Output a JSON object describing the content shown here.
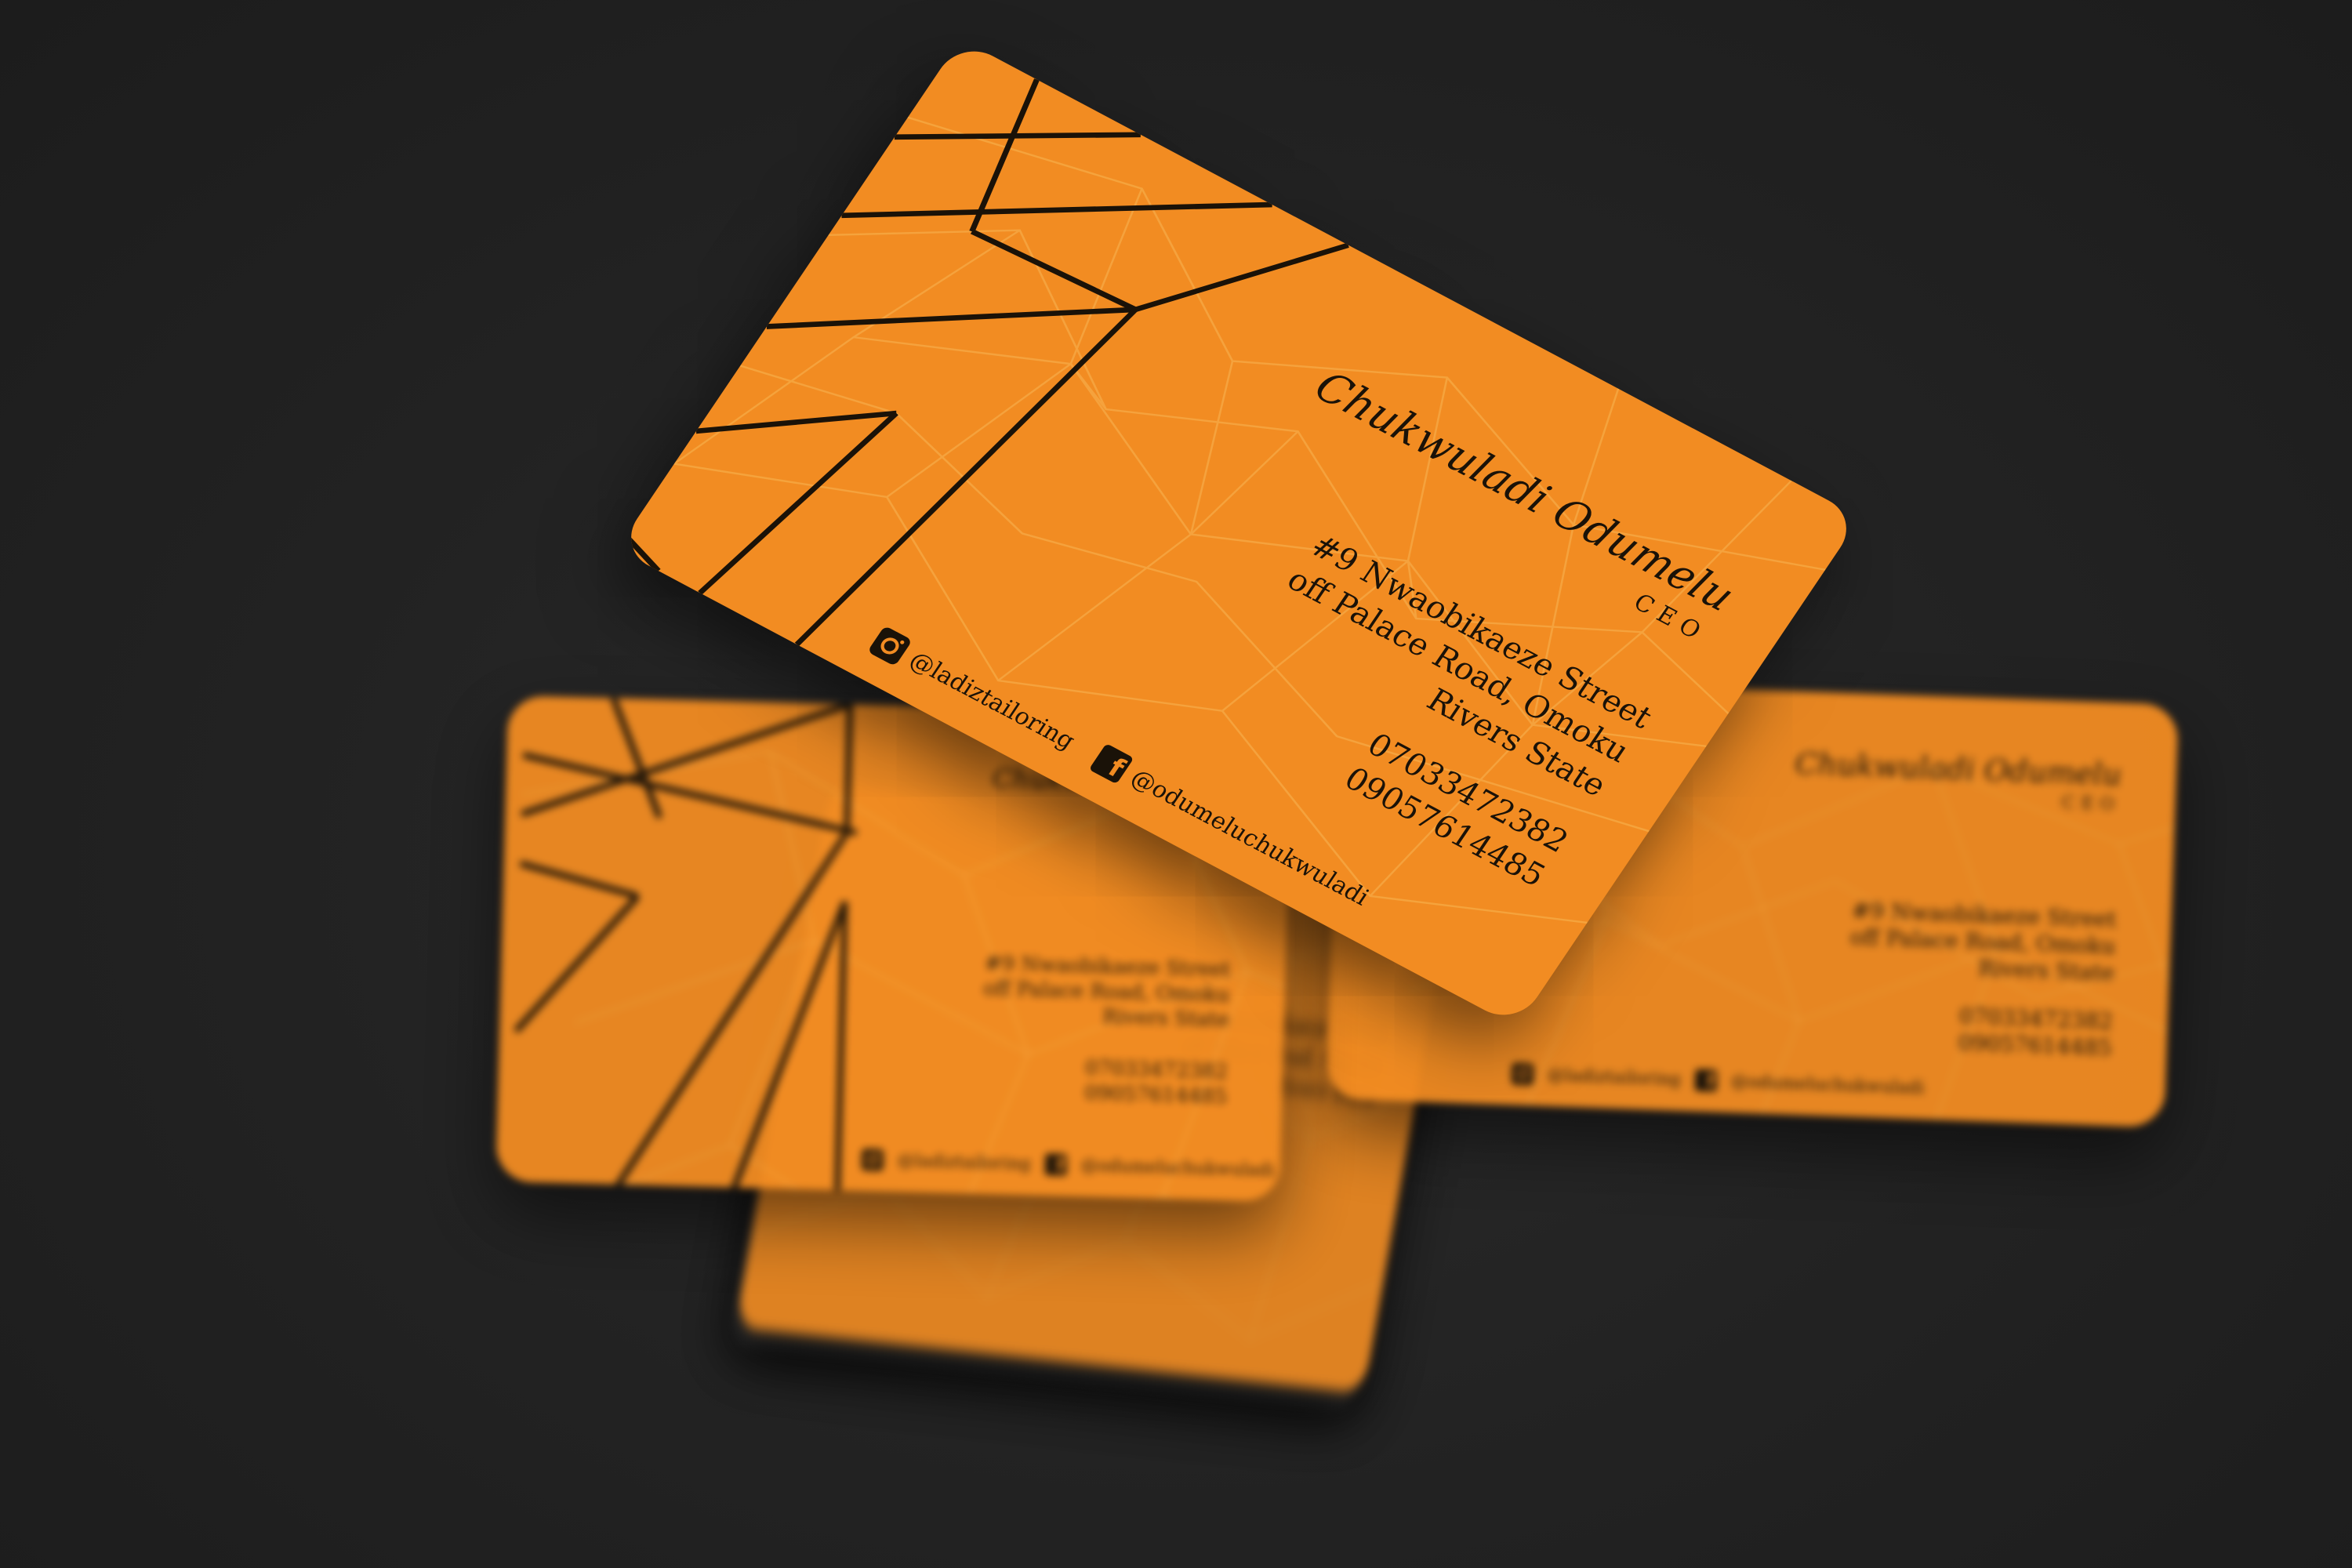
{
  "card": {
    "name": "Chukwuladi Odumelu",
    "title": "CEO",
    "address_line1": "#9 Nwaobikaeze Street",
    "address_line2": "off Palace Road, Omoku",
    "address_line3": "Rivers State",
    "phone1": "07033472382",
    "phone2": "09057614485",
    "instagram": "@ladiztailoring",
    "facebook": "@odumeluchukwuladi"
  },
  "colors": {
    "background": "#232323",
    "card": "#f28c22",
    "ink": "#1a1208",
    "pattern_light": "#f7b24f"
  },
  "icons": {
    "instagram": "instagram-icon",
    "facebook": "facebook-icon"
  }
}
